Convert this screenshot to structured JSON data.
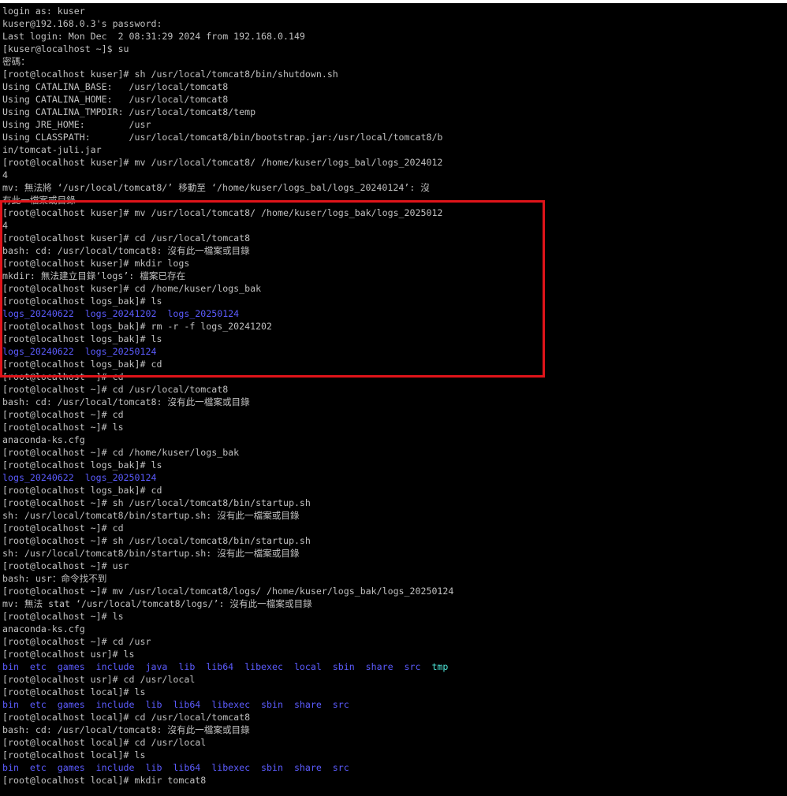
{
  "colors": {
    "background": "#000000",
    "text": "#c0c0c0",
    "directory": "#5c5cff",
    "tmp_dir": "#4ee6d8",
    "highlight_border": "#e0141a"
  },
  "terminal": {
    "lines": [
      [
        {
          "t": "login as: kuser"
        }
      ],
      [
        {
          "t": "kuser@192.168.0.3's password:"
        }
      ],
      [
        {
          "t": "Last login: Mon Dec  2 08:31:29 2024 from 192.168.0.149"
        }
      ],
      [
        {
          "t": "[kuser@localhost ~]$ su"
        }
      ],
      [
        {
          "t": "密碼："
        }
      ],
      [
        {
          "t": "[root@localhost kuser]# sh /usr/local/tomcat8/bin/shutdown.sh"
        }
      ],
      [
        {
          "t": "Using CATALINA_BASE:   /usr/local/tomcat8"
        }
      ],
      [
        {
          "t": "Using CATALINA_HOME:   /usr/local/tomcat8"
        }
      ],
      [
        {
          "t": "Using CATALINA_TMPDIR: /usr/local/tomcat8/temp"
        }
      ],
      [
        {
          "t": "Using JRE_HOME:        /usr"
        }
      ],
      [
        {
          "t": "Using CLASSPATH:       /usr/local/tomcat8/bin/bootstrap.jar:/usr/local/tomcat8/b"
        }
      ],
      [
        {
          "t": "in/tomcat-juli.jar"
        }
      ],
      [
        {
          "t": "[root@localhost kuser]# mv /usr/local/tomcat8/ /home/kuser/logs_bal/logs_2024012"
        }
      ],
      [
        {
          "t": "4"
        }
      ],
      [
        {
          "t": "mv: 無法將 ‘/usr/local/tomcat8/’ 移動至 ‘/home/kuser/logs_bal/logs_20240124’: 沒"
        }
      ],
      [
        {
          "t": "有此一檔案或目錄"
        }
      ],
      [
        {
          "t": "[root@localhost kuser]# mv /usr/local/tomcat8/ /home/kuser/logs_bak/logs_2025012"
        }
      ],
      [
        {
          "t": "4"
        }
      ],
      [
        {
          "t": "[root@localhost kuser]# cd /usr/local/tomcat8"
        }
      ],
      [
        {
          "t": "bash: cd: /usr/local/tomcat8: 沒有此一檔案或目錄"
        }
      ],
      [
        {
          "t": "[root@localhost kuser]# mkdir logs"
        }
      ],
      [
        {
          "t": "mkdir: 無法建立目錄‘logs’: 檔案已存在"
        }
      ],
      [
        {
          "t": "[root@localhost kuser]# cd /home/kuser/logs_bak"
        }
      ],
      [
        {
          "t": "[root@localhost logs_bak]# ls"
        }
      ],
      [
        {
          "t": "logs_20240622  logs_20241202  logs_20250124",
          "c": "dir"
        }
      ],
      [
        {
          "t": "[root@localhost logs_bak]# rm -r -f logs_20241202"
        }
      ],
      [
        {
          "t": "[root@localhost logs_bak]# ls"
        }
      ],
      [
        {
          "t": "logs_20240622  logs_20250124",
          "c": "dir"
        }
      ],
      [
        {
          "t": "[root@localhost logs_bak]# cd"
        }
      ],
      [
        {
          "t": "[root@localhost ~]# cd"
        }
      ],
      [
        {
          "t": "[root@localhost ~]# cd /usr/local/tomcat8"
        }
      ],
      [
        {
          "t": "bash: cd: /usr/local/tomcat8: 沒有此一檔案或目錄"
        }
      ],
      [
        {
          "t": "[root@localhost ~]# cd"
        }
      ],
      [
        {
          "t": "[root@localhost ~]# ls"
        }
      ],
      [
        {
          "t": "anaconda-ks.cfg"
        }
      ],
      [
        {
          "t": "[root@localhost ~]# cd /home/kuser/logs_bak"
        }
      ],
      [
        {
          "t": "[root@localhost logs_bak]# ls"
        }
      ],
      [
        {
          "t": "logs_20240622  logs_20250124",
          "c": "dir"
        }
      ],
      [
        {
          "t": "[root@localhost logs_bak]# cd"
        }
      ],
      [
        {
          "t": "[root@localhost ~]# sh /usr/local/tomcat8/bin/startup.sh"
        }
      ],
      [
        {
          "t": "sh: /usr/local/tomcat8/bin/startup.sh: 沒有此一檔案或目錄"
        }
      ],
      [
        {
          "t": "[root@localhost ~]# cd"
        }
      ],
      [
        {
          "t": "[root@localhost ~]# sh /usr/local/tomcat8/bin/startup.sh"
        }
      ],
      [
        {
          "t": "sh: /usr/local/tomcat8/bin/startup.sh: 沒有此一檔案或目錄"
        }
      ],
      [
        {
          "t": "[root@localhost ~]# usr"
        }
      ],
      [
        {
          "t": "bash: usr：命令找不到"
        }
      ],
      [
        {
          "t": "[root@localhost ~]# mv /usr/local/tomcat8/logs/ /home/kuser/logs_bak/logs_20250124"
        }
      ],
      [
        {
          "t": "mv: 無法 stat ‘/usr/local/tomcat8/logs/’: 沒有此一檔案或目錄"
        }
      ],
      [
        {
          "t": "[root@localhost ~]# ls"
        }
      ],
      [
        {
          "t": "anaconda-ks.cfg"
        }
      ],
      [
        {
          "t": "[root@localhost ~]# cd /usr"
        }
      ],
      [
        {
          "t": "[root@localhost usr]# ls"
        }
      ],
      [
        {
          "t": "bin  etc  games  include  java  lib  lib64  libexec  local  sbin  share  src  ",
          "c": "dir"
        },
        {
          "t": "tmp",
          "c": "cyan"
        }
      ],
      [
        {
          "t": "[root@localhost usr]# cd /usr/local"
        }
      ],
      [
        {
          "t": "[root@localhost local]# ls"
        }
      ],
      [
        {
          "t": "bin  etc  games  include  lib  lib64  libexec  sbin  share  src",
          "c": "dir"
        }
      ],
      [
        {
          "t": "[root@localhost local]# cd /usr/local/tomcat8"
        }
      ],
      [
        {
          "t": "bash: cd: /usr/local/tomcat8: 沒有此一檔案或目錄"
        }
      ],
      [
        {
          "t": "[root@localhost local]# cd /usr/local"
        }
      ],
      [
        {
          "t": "[root@localhost local]# ls"
        }
      ],
      [
        {
          "t": "bin  etc  games  include  lib  lib64  libexec  sbin  share  src",
          "c": "dir"
        }
      ],
      [
        {
          "t": "[root@localhost local]# mkdir tomcat8"
        }
      ]
    ]
  }
}
